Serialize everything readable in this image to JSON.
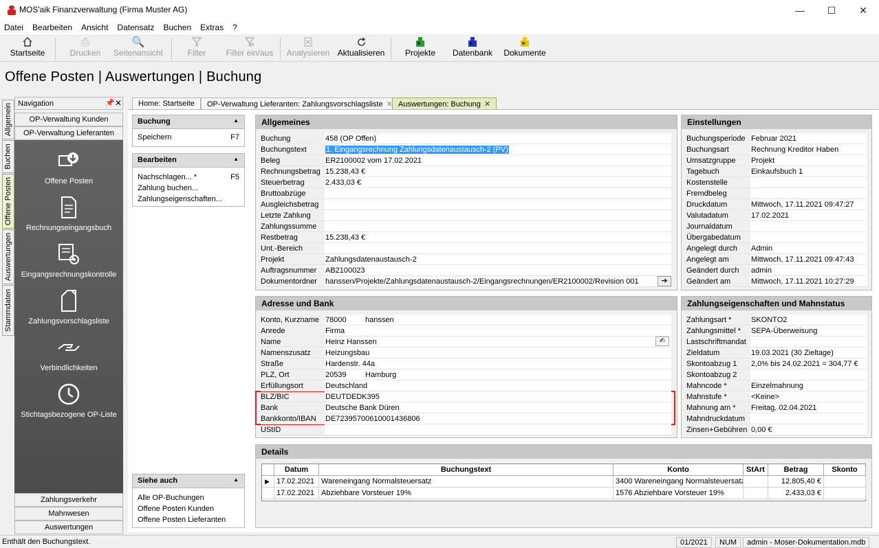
{
  "window": {
    "title": "MOS'aik Finanzverwaltung (Firma Muster AG)"
  },
  "menu": [
    "Datei",
    "Bearbeiten",
    "Ansicht",
    "Datensatz",
    "Buchen",
    "Extras",
    "?"
  ],
  "toolbar": {
    "startseite": "Startseite",
    "drucken": "Drucken",
    "seitenansicht": "Seitenansicht",
    "filter": "Filter",
    "filter_einaus": "Filter ein/aus",
    "analysieren": "Analysieren",
    "aktualisieren": "Aktualisieren",
    "projekte": "Projekte",
    "datenbank": "Datenbank",
    "dokumente": "Dokumente"
  },
  "page_title": "Offene Posten | Auswertungen | Buchung",
  "vertical_tabs": [
    "Allgemein",
    "Buchen",
    "Offene Posten",
    "Auswertungen",
    "Stammdaten"
  ],
  "navigation": {
    "header": "Navigation",
    "top_buttons": [
      "OP-Verwaltung Kunden",
      "OP-Verwaltung Lieferanten"
    ],
    "items": [
      "Offene Posten",
      "Rechnungseingangsbuch",
      "Eingangsrechnungskontrolle",
      "Zahlungsvorschlagsliste",
      "Verbindlichkeiten",
      "Stichtagsbezogene OP-Liste"
    ],
    "bottom_buttons": [
      "Zahlungsverkehr",
      "Mahnwesen",
      "Auswertungen"
    ]
  },
  "doc_tabs": [
    "Home: Startseite",
    "OP-Verwaltung Lieferanten: Zahlungsvorschlagsliste",
    "Auswertungen: Buchung"
  ],
  "side_panels": {
    "buchung": {
      "title": "Buchung",
      "items": [
        {
          "label": "Speichern",
          "key": "F7"
        }
      ]
    },
    "bearbeiten": {
      "title": "Bearbeiten",
      "items": [
        {
          "label": "Nachschlagen... *",
          "key": "F5"
        },
        {
          "label": "Zahlung buchen...",
          "key": ""
        },
        {
          "label": "Zahlungseigenschaften...",
          "key": ""
        }
      ]
    },
    "siehe_auch": {
      "title": "Siehe auch",
      "items": [
        "Alle OP-Buchungen",
        "Offene Posten Kunden",
        "Offene Posten Lieferanten"
      ]
    }
  },
  "allgemeines": {
    "title": "Allgemeines",
    "fields": [
      {
        "label": "Buchung",
        "value": "458 (OP Offen)"
      },
      {
        "label": "Buchungstext",
        "value": "1. Eingangsrechnung Zahlungsdatenaustausch-2 (PV)"
      },
      {
        "label": "Beleg",
        "value": "ER2100002 vom 17.02.2021"
      },
      {
        "label": "Rechnungsbetrag",
        "value": "15.238,43 €"
      },
      {
        "label": "Steuerbetrag",
        "value": "2.433,03 €"
      },
      {
        "label": "Bruttoabzüge",
        "value": ""
      },
      {
        "label": "Ausgleichsbetrag",
        "value": ""
      },
      {
        "label": "Letzte Zahlung",
        "value": ""
      },
      {
        "label": "Zahlungssumme",
        "value": ""
      },
      {
        "label": "Restbetrag",
        "value": "15.238,43 €"
      },
      {
        "label": "Unt.-Bereich",
        "value": ""
      },
      {
        "label": "Projekt",
        "value": "Zahlungsdatenaustausch-2"
      },
      {
        "label": "Auftragsnummer",
        "value": "AB2100023"
      },
      {
        "label": "Dokumentordner",
        "value": "hanssen/Projekte/Zahlungsdatenaustausch-2/Eingangsrechnungen/ER2100002/Revision 001"
      }
    ]
  },
  "adresse": {
    "title": "Adresse und Bank",
    "fields": [
      {
        "label": "Konto, Kurzname",
        "value": "78000",
        "value2": "hanssen"
      },
      {
        "label": "Anrede",
        "value": "Firma"
      },
      {
        "label": "Name",
        "value": "Heinz Hanssen"
      },
      {
        "label": "Namenszusatz",
        "value": "Heizungsbau"
      },
      {
        "label": "Straße",
        "value": "Hardenstr. 44a"
      },
      {
        "label": "PLZ, Ort",
        "value": "20539",
        "value2": "Hamburg"
      },
      {
        "label": "Erfüllungsort",
        "value": "Deutschland"
      },
      {
        "label": "BLZ/BIC",
        "value": "DEUTDEDK395"
      },
      {
        "label": "Bank",
        "value": "Deutsche Bank Düren"
      },
      {
        "label": "Bankkonto/IBAN",
        "value": "DE72395700610001436806"
      },
      {
        "label": "UStID",
        "value": ""
      }
    ]
  },
  "einstellungen": {
    "title": "Einstellungen",
    "fields": [
      {
        "label": "Buchungsperiode",
        "value": "Februar 2021"
      },
      {
        "label": "Buchungsart",
        "value": "Rechnung Kreditor Haben"
      },
      {
        "label": "Umsatzgruppe",
        "value": "Projekt"
      },
      {
        "label": "Tagebuch",
        "value": "Einkaufsbuch 1"
      },
      {
        "label": "Kostenstelle",
        "value": ""
      },
      {
        "label": "Fremdbeleg",
        "value": ""
      },
      {
        "label": "Druckdatum",
        "value": "Mittwoch, 17.11.2021 09:47:27"
      },
      {
        "label": "Valutadatum",
        "value": "17.02.2021"
      },
      {
        "label": "Journaldatum",
        "value": ""
      },
      {
        "label": "Übergabedatum",
        "value": ""
      },
      {
        "label": "Angelegt durch",
        "value": "Admin"
      },
      {
        "label": "Angelegt am",
        "value": "Mittwoch, 17.11.2021 09:47:43"
      },
      {
        "label": "Geändert durch",
        "value": "admin"
      },
      {
        "label": "Geändert am",
        "value": "Mittwoch, 17.11.2021 10:27:29"
      }
    ]
  },
  "zahlung": {
    "title": "Zahlungseigenschaften und Mahnstatus",
    "fields": [
      {
        "label": "Zahlungsart *",
        "value": "SKONTO2"
      },
      {
        "label": "Zahlungsmittel *",
        "value": "SEPA-Überweisung"
      },
      {
        "label": "Lastschriftmandat",
        "value": ""
      },
      {
        "label": "Zieldatum",
        "value": "19.03.2021 (30 Zieltage)"
      },
      {
        "label": "Skontoabzug 1",
        "value": "2,0% bis 24.02.2021 = 304,77 €"
      },
      {
        "label": "Skontoabzug 2",
        "value": ""
      },
      {
        "label": "Mahncode *",
        "value": "Einzelmahnung"
      },
      {
        "label": "Mahnstufe *",
        "value": "<Keine>"
      },
      {
        "label": "Mahnung am *",
        "value": "Freitag, 02.04.2021"
      },
      {
        "label": "Mahndruckdatum",
        "value": ""
      },
      {
        "label": "Zinsen+Gebühren",
        "value": "0,00 €"
      }
    ]
  },
  "details": {
    "title": "Details",
    "columns": [
      "Datum",
      "Buchungstext",
      "Konto",
      "StArt",
      "Betrag",
      "Skonto"
    ],
    "rows": [
      [
        "17.02.2021",
        "Wareneingang Normalsteuersatz",
        "3400 Wareneingang Normalsteuersatz",
        "",
        "12.805,40 €",
        ""
      ],
      [
        "17.02.2021",
        "Abziehbare Vorsteuer 19%",
        "1576 Abziehbare Vorsteuer 19%",
        "",
        "2.433,03 €",
        ""
      ]
    ]
  },
  "statusbar": {
    "hint": "Enthält den Buchungstext.",
    "period": "01/2021",
    "num": "NUM",
    "db": "admin - Moser-Dokumentation.mdb"
  },
  "colors": {
    "highlight_border": "#e02020",
    "active_tab": "#e1ecc2",
    "selection": "#3399ff"
  }
}
